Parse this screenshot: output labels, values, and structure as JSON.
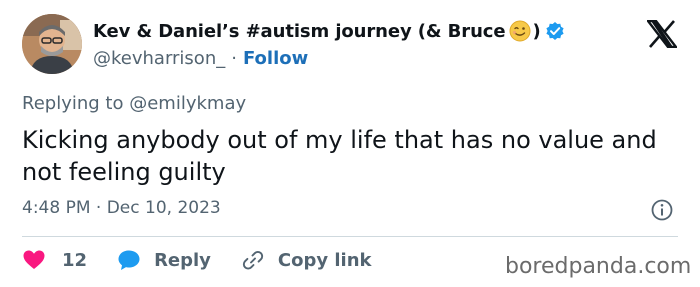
{
  "author": {
    "display_name": "Kev & Daniel’s #autism journey (& Bruce",
    "display_name_suffix": ")",
    "emoji": "winking-face-icon",
    "verified_color": "#1d9bf0",
    "handle": "@kevharrison_",
    "separator": "·",
    "follow_label": "Follow",
    "follow_color": "#1d6fb8"
  },
  "brand": {
    "logo": "x-logo-icon"
  },
  "reply_context": {
    "prefix": "Replying to",
    "target": "@emilykmay"
  },
  "tweet": {
    "text": "Kicking anybody out of my life that has no value and not feeling guilty",
    "time": "4:48 PM",
    "separator": "·",
    "date": "Dec 10, 2023"
  },
  "actions": {
    "like_count": "12",
    "like_color": "#f91880",
    "reply_label": "Reply",
    "reply_color": "#1d9bf0",
    "copy_label": "Copy link"
  },
  "watermark": "boredpanda.com"
}
